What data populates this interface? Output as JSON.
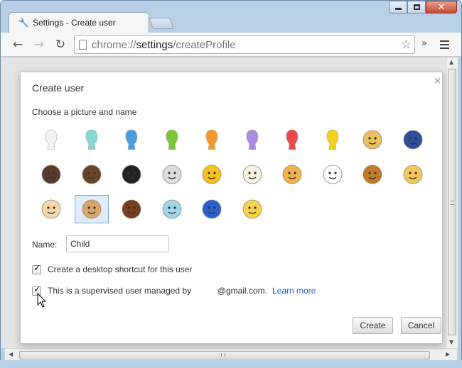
{
  "window": {
    "tab_title": "Settings - Create user",
    "tab_icon": "wrench-icon"
  },
  "toolbar": {
    "url_scheme": "chrome://",
    "url_host": "settings",
    "url_path": "/createProfile",
    "back_icon": "←",
    "forward_icon": "→",
    "reload_icon": "↻",
    "star_icon": "☆",
    "overflow_icon": "»"
  },
  "dialog": {
    "title": "Create user",
    "subtitle": "Choose a picture and name",
    "name_label": "Name:",
    "name_value": "Child",
    "desktop_shortcut_label": "Create a desktop shortcut for this user",
    "desktop_shortcut_checked": true,
    "supervised_label": "This is a supervised user managed by           @gmail.com.",
    "supervised_checked": true,
    "learn_more": "Learn more",
    "create_button": "Create",
    "cancel_button": "Cancel"
  },
  "avatars": [
    {
      "name": "white-silhouette",
      "color": "#f2f2f2"
    },
    {
      "name": "cyan-silhouette",
      "color": "#86d8d4"
    },
    {
      "name": "blue-silhouette",
      "color": "#4b9de0"
    },
    {
      "name": "green-silhouette",
      "color": "#7cc43a"
    },
    {
      "name": "orange-silhouette",
      "color": "#f29a2e"
    },
    {
      "name": "purple-silhouette",
      "color": "#a98be0"
    },
    {
      "name": "red-silhouette",
      "color": "#e84a4a"
    },
    {
      "name": "yellow-silhouette",
      "color": "#f2d21e"
    },
    {
      "name": "blonde-woman-avatar",
      "color": "#e8c15a"
    },
    {
      "name": "superhero-avatar",
      "color": "#2c4f9e"
    },
    {
      "name": "businesswoman-avatar",
      "color": "#5a3a2a"
    },
    {
      "name": "businessman-avatar",
      "color": "#6b4426"
    },
    {
      "name": "ninja-avatar",
      "color": "#222222"
    },
    {
      "name": "alien-avatar",
      "color": "#dcdcdc"
    },
    {
      "name": "smiley-avatar",
      "color": "#f5c21b"
    },
    {
      "name": "flower-avatar",
      "color": "#f7f3e0"
    },
    {
      "name": "pizza-avatar",
      "color": "#f0b24a"
    },
    {
      "name": "soccer-ball-avatar",
      "color": "#ffffff"
    },
    {
      "name": "hamburger-avatar",
      "color": "#c47a2c"
    },
    {
      "name": "cat-avatar",
      "color": "#f4c75a"
    },
    {
      "name": "cupcake-avatar",
      "color": "#f6d7a8"
    },
    {
      "name": "dog-avatar",
      "color": "#d9a765",
      "selected": true
    },
    {
      "name": "horse-avatar",
      "color": "#7a3d1c"
    },
    {
      "name": "cocktail-avatar",
      "color": "#9fd6e8"
    },
    {
      "name": "music-note-avatar",
      "color": "#2860d0"
    },
    {
      "name": "sun-cloud-avatar",
      "color": "#f6d14a"
    }
  ]
}
